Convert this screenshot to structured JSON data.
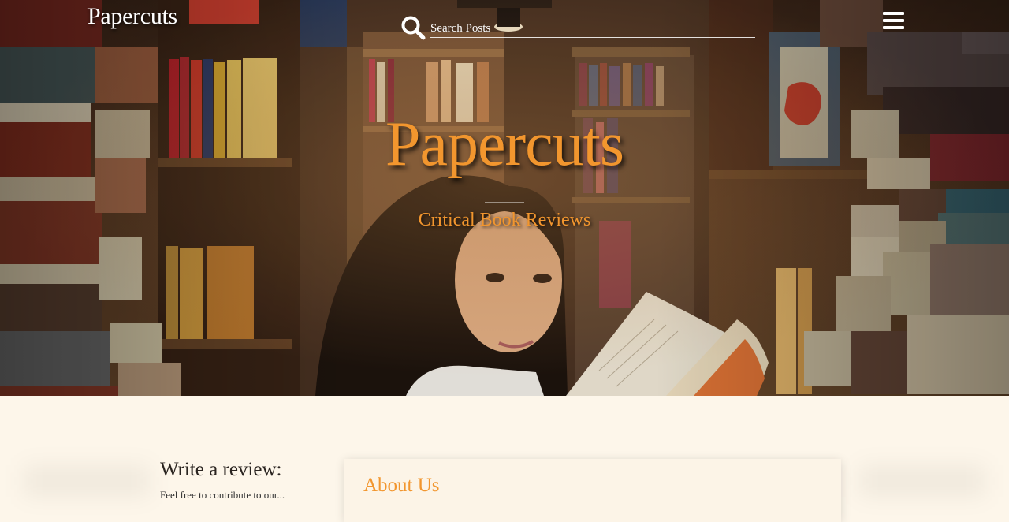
{
  "header": {
    "logo": "Papercuts",
    "search": {
      "placeholder": "Search Posts",
      "value": ""
    },
    "menu_icon": "hamburger-menu-icon",
    "search_icon": "search-icon"
  },
  "hero": {
    "title": "Papercuts",
    "subtitle": "Critical Book Reviews",
    "background_image": "woman-reading-in-bookstore-photo"
  },
  "sidebar": {
    "heading": "Write a review:",
    "text": "Feel free to contribute to our..."
  },
  "about": {
    "title": "About Us"
  },
  "colors": {
    "accent": "#f2962e",
    "page_bg": "#fdf6ea",
    "card_bg": "#fcf4e7",
    "header_text": "#ffffff"
  }
}
